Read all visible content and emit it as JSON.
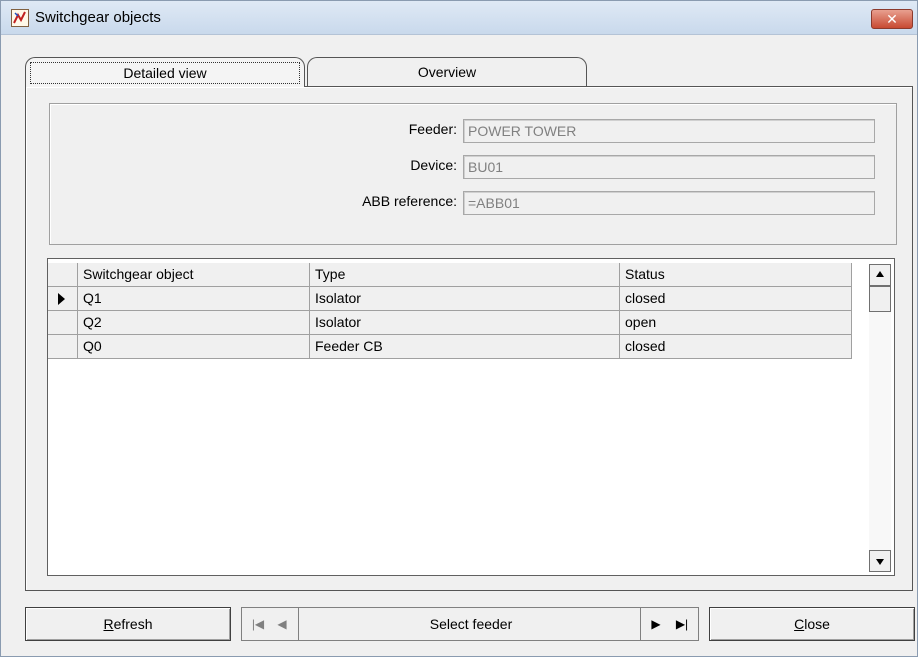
{
  "window": {
    "title": "Switchgear objects",
    "close_glyph": "✕"
  },
  "tabs": [
    {
      "label": "Detailed view",
      "selected": true
    },
    {
      "label": "Overview",
      "selected": false
    }
  ],
  "fields": {
    "feeder": {
      "label": "Feeder:",
      "value": "POWER TOWER"
    },
    "device": {
      "label": "Device:",
      "value": "BU01"
    },
    "abb_reference": {
      "label": "ABB reference:",
      "value": "=ABB01"
    }
  },
  "grid": {
    "columns": [
      "Switchgear object",
      "Type",
      "Status"
    ],
    "rows": [
      {
        "object": "Q1",
        "type": "Isolator",
        "status": "closed",
        "current": true
      },
      {
        "object": "Q2",
        "type": "Isolator",
        "status": "open",
        "current": false
      },
      {
        "object": "Q0",
        "type": "Feeder CB",
        "status": "closed",
        "current": false
      }
    ]
  },
  "buttons": {
    "refresh_first": "R",
    "refresh_rest": "efresh",
    "close_first": "C",
    "close_rest": "lose"
  },
  "navigator": {
    "first_glyph": "|◀",
    "prev_glyph": "◀",
    "label": "Select feeder",
    "next_glyph": "▶",
    "last_glyph": "▶|"
  }
}
